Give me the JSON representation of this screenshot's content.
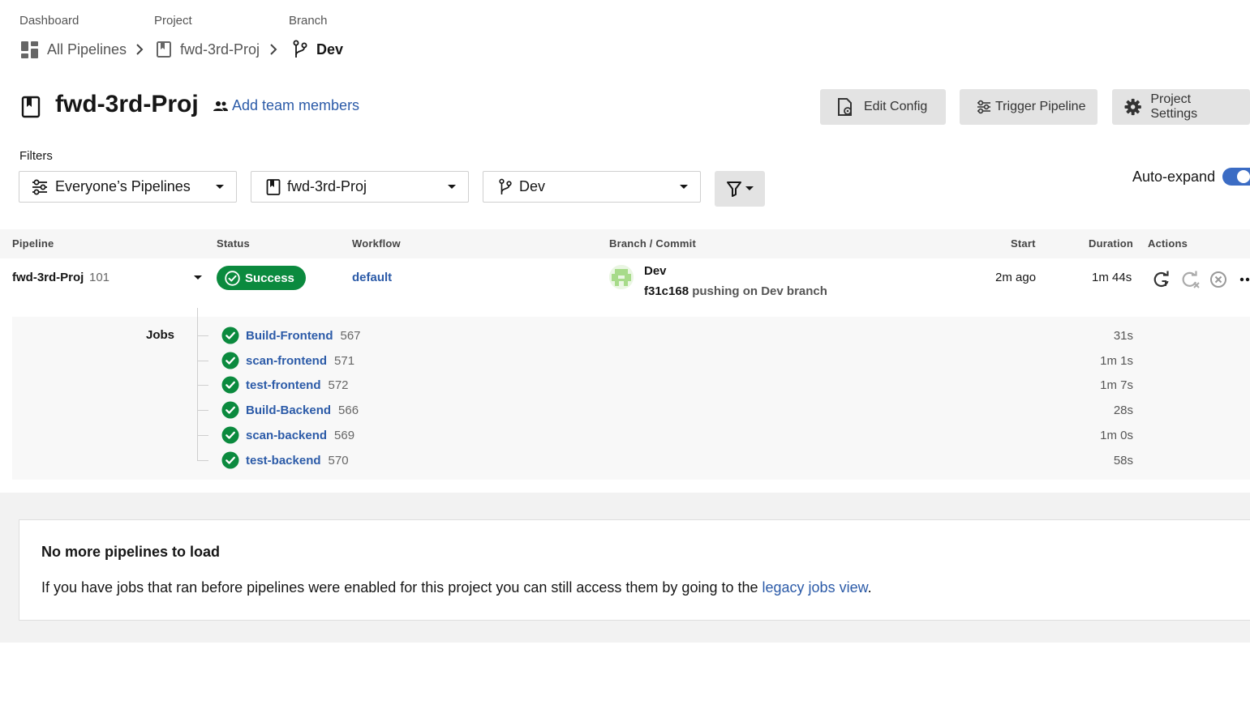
{
  "breadcrumb": {
    "labels": [
      "Dashboard",
      "Project",
      "Branch"
    ],
    "items": [
      {
        "label": "All Pipelines",
        "icon": "dashboard-icon"
      },
      {
        "label": "fwd-3rd-Proj",
        "icon": "project-bookmark-icon"
      },
      {
        "label": "Dev",
        "icon": "branch-icon"
      }
    ]
  },
  "header": {
    "title": "fwd-3rd-Proj",
    "add_team": "Add team members",
    "buttons": {
      "edit_config": "Edit Config",
      "trigger_pipeline": "Trigger Pipeline",
      "project_settings": "Project Settings"
    }
  },
  "filters": {
    "label": "Filters",
    "pipelines": "Everyone’s Pipelines",
    "project": "fwd-3rd-Proj",
    "branch": "Dev",
    "autoexpand_label": "Auto-expand",
    "autoexpand_on": true
  },
  "table": {
    "headers": {
      "pipeline": "Pipeline",
      "status": "Status",
      "workflow": "Workflow",
      "branch_commit": "Branch / Commit",
      "start": "Start",
      "duration": "Duration",
      "actions": "Actions"
    },
    "row": {
      "pipeline": "fwd-3rd-Proj",
      "number": "101",
      "status": "Success",
      "workflow": "default",
      "branch": "Dev",
      "commit_sha": "f31c168",
      "commit_msg": "pushing on Dev branch",
      "start": "2m ago",
      "duration": "1m 44s"
    }
  },
  "jobs": {
    "label": "Jobs",
    "items": [
      {
        "name": "Build-Frontend",
        "number": "567",
        "duration": "31s"
      },
      {
        "name": "scan-frontend",
        "number": "571",
        "duration": "1m 1s"
      },
      {
        "name": "test-frontend",
        "number": "572",
        "duration": "1m 7s"
      },
      {
        "name": "Build-Backend",
        "number": "566",
        "duration": "28s"
      },
      {
        "name": "scan-backend",
        "number": "569",
        "duration": "1m 0s"
      },
      {
        "name": "test-backend",
        "number": "570",
        "duration": "58s"
      }
    ]
  },
  "footer": {
    "title": "No more pipelines to load",
    "text_before": "If you have jobs that ran before pipelines were enabled for this project you can still access them by going to the ",
    "link": "legacy jobs view",
    "text_after": "."
  },
  "colors": {
    "accent": "#2c5ba8",
    "success": "#0b8a3e",
    "toggle": "#3b6cc4",
    "button_bg": "#e3e3e3"
  }
}
